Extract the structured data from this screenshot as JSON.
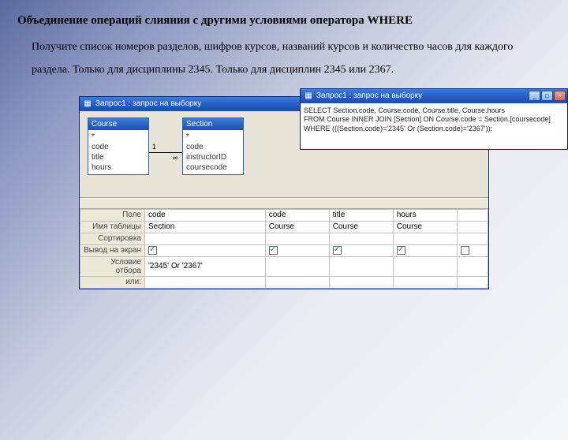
{
  "heading": "Объединение операций слияния с другими условиями оператора WHERE",
  "paragraph": "Получите список номеров разделов, шифров курсов, названий курсов и количество часов для каждого раздела. Только для дисциплины 2345. Только для дисциплин 2345 или 2367.",
  "main_window": {
    "title": "Запрос1 : запрос на выборку",
    "tables": {
      "left": {
        "name": "Course",
        "fields": [
          "*",
          "code",
          "title",
          "hours"
        ]
      },
      "right": {
        "name": "Section",
        "fields": [
          "*",
          "code",
          "instructorID",
          "coursecode"
        ]
      }
    },
    "join": {
      "from_mult": "1",
      "to_mult": "∞"
    },
    "grid": {
      "labels": {
        "field": "Поле",
        "table": "Имя таблицы",
        "sort": "Сортировка",
        "show": "Вывод на экран",
        "criteria": "Условие отбора",
        "or": "или:"
      },
      "cols": [
        {
          "field": "code",
          "table": "Section",
          "show": true,
          "criteria": "'2345' Or '2367'"
        },
        {
          "field": "code",
          "table": "Course",
          "show": true,
          "criteria": ""
        },
        {
          "field": "title",
          "table": "Course",
          "show": true,
          "criteria": ""
        },
        {
          "field": "hours",
          "table": "Course",
          "show": true,
          "criteria": ""
        }
      ]
    }
  },
  "sql_window": {
    "title": "Запрос1 : запрос на выборку",
    "sql_lines": [
      "SELECT Section.code, Course.code, Course.title, Course.hours",
      "FROM Course INNER JOIN [Section] ON Course.code = Section.[coursecode]",
      "WHERE (((Section.code)='2345' Or (Section.code)='2367'));"
    ]
  }
}
